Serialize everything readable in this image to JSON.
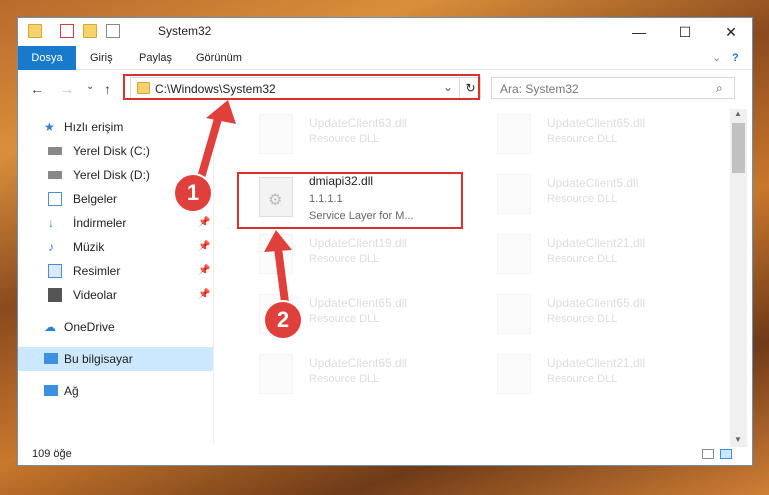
{
  "window": {
    "title": "System32"
  },
  "ribbon": {
    "tabs": [
      "Dosya",
      "Giriş",
      "Paylaş",
      "Görünüm"
    ]
  },
  "address": {
    "path": "C:\\Windows\\System32"
  },
  "search": {
    "placeholder": "Ara: System32"
  },
  "sidebar": {
    "items": [
      {
        "label": "Hızlı erişim"
      },
      {
        "label": "Yerel Disk (C:)"
      },
      {
        "label": "Yerel Disk (D:)"
      },
      {
        "label": "Belgeler"
      },
      {
        "label": "İndirmeler"
      },
      {
        "label": "Müzik"
      },
      {
        "label": "Resimler"
      },
      {
        "label": "Videolar"
      },
      {
        "label": "OneDrive"
      },
      {
        "label": "Bu bilgisayar"
      },
      {
        "label": "Ağ"
      }
    ]
  },
  "files": [
    {
      "name": "UpdateClient63.dll",
      "desc": "Resource DLL"
    },
    {
      "name": "UpdateClient65.dll",
      "desc": "Resource DLL"
    },
    {
      "name": "dmiapi32.dll",
      "version": "1.1.1.1",
      "desc": "Service Layer for M..."
    },
    {
      "name": "UpdateClient5.dll",
      "desc": "Resource DLL"
    },
    {
      "name": "UpdateClient19.dll",
      "desc": "Resource DLL"
    },
    {
      "name": "UpdateClient21.dll",
      "desc": "Resource DLL"
    },
    {
      "name": "UpdateClient65.dll",
      "desc": "Resource DLL"
    },
    {
      "name": "UpdateClient65.dll",
      "desc": "Resource DLL"
    },
    {
      "name": "UpdateClient65.dll",
      "desc": "Resource DLL"
    },
    {
      "name": "UpdateClient21.dll",
      "desc": "Resource DLL"
    }
  ],
  "status": {
    "count": "109 öğe"
  },
  "annotations": {
    "step1": "1",
    "step2": "2"
  },
  "colors": {
    "accent": "#1979ca",
    "highlight": "#d9312c"
  }
}
